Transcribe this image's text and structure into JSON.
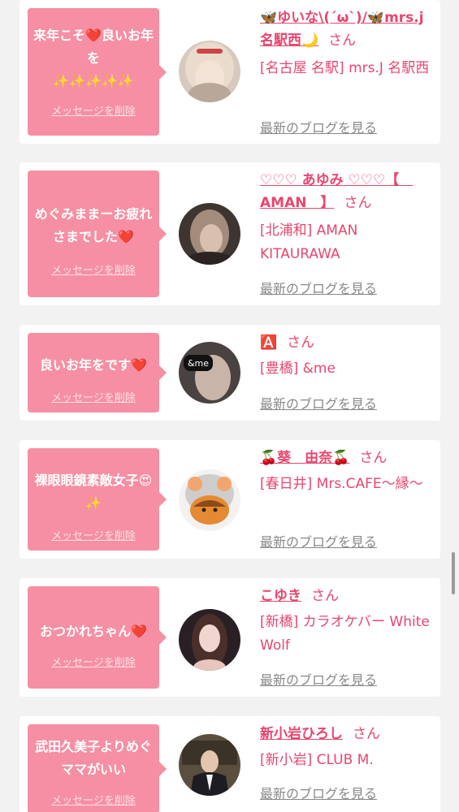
{
  "messages": [
    {
      "bubble_text": "来年こそ❤️良いお年を\n✨✨✨✨✨",
      "delete_label": "メッセージを削除",
      "name": "🦋ゆいな\\(´ω`)/🦋mrs.j名駅西🌙",
      "san": "さん",
      "shop": "[名古屋 名駅] mrs.J 名駅西",
      "blog": "最新のブログを見る",
      "avatar_icon": "girl-blonde-avatar"
    },
    {
      "bubble_text": "めぐみままーお疲れさまでした❤️",
      "delete_label": "メッセージを削除",
      "name": "♡♡♡ あゆみ ♡♡♡【　AMAN　】",
      "san": "さん",
      "shop": "[北浦和] AMAN KITAURAWA",
      "blog": "最新のブログを見る",
      "avatar_icon": "girl-dark-avatar"
    },
    {
      "bubble_text": "良いお年をです❤️",
      "delete_label": "メッセージを削除",
      "name": "🅰️",
      "san": "さん",
      "shop": "[豊橋] &me",
      "blog": "最新のブログを見る",
      "avatar_icon": "girl-andme-avatar"
    },
    {
      "bubble_text": "裸眼眼鏡素敵女子😍✨",
      "delete_label": "メッセージを削除",
      "name": "🍒葵　由奈🍒",
      "san": "さん",
      "shop": "[春日井] Mrs.CAFE〜縁〜",
      "blog": "最新のブログを見る",
      "avatar_icon": "bear-filter-avatar"
    },
    {
      "bubble_text": "おつかれちゃん❤️",
      "delete_label": "メッセージを削除",
      "name": "こゆき",
      "san": "さん",
      "shop": "[新橋] カラオケバー White Wolf",
      "blog": "最新のブログを見る",
      "avatar_icon": "girl-longhair-avatar"
    },
    {
      "bubble_text": "武田久美子よりめぐママがいい",
      "delete_label": "メッセージを削除",
      "name": "新小岩ひろし",
      "san": "さん",
      "shop": "[新小岩] CLUB M.",
      "blog": "最新のブログを見る",
      "avatar_icon": "man-suit-avatar"
    }
  ],
  "colors": {
    "accent": "#e8466e",
    "bubble": "#f68fa3",
    "background": "#f2f2f2"
  }
}
